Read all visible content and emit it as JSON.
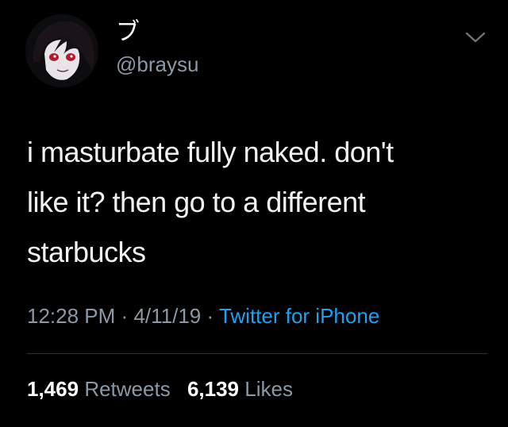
{
  "user": {
    "display_name": "ブ",
    "handle": "@braysu"
  },
  "tweet": {
    "lines": [
      "i masturbate fully naked. don't",
      "like it? then go to a different",
      "starbucks"
    ],
    "time": "12:28 PM",
    "date": "4/11/19",
    "separator": "·",
    "source": "Twitter for iPhone"
  },
  "stats": {
    "retweets_count": "1,469",
    "retweets_label": "Retweets",
    "likes_count": "6,139",
    "likes_label": "Likes"
  },
  "icons": {
    "menu": "chevron-down-icon",
    "avatar": "profile-avatar"
  },
  "colors": {
    "background": "#000000",
    "text": "#ffffff",
    "secondary": "#8b98a5",
    "link": "#1da1f2"
  }
}
